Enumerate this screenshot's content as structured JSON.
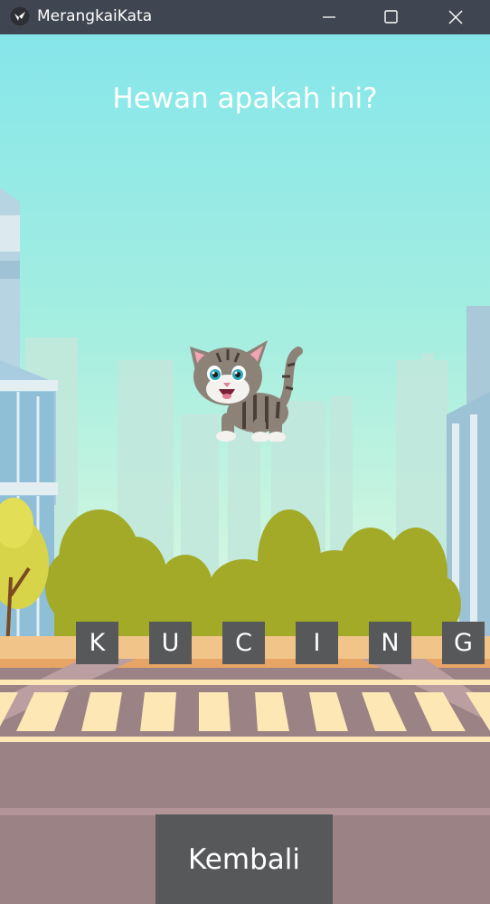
{
  "window": {
    "title": "MerangkaiKata",
    "icon": "kivy-logo-icon"
  },
  "game": {
    "question": "Hewan apakah ini?",
    "image": "cat-illustration",
    "letters": [
      "K",
      "U",
      "C",
      "I",
      "N",
      "G"
    ],
    "back_label": "Kembali"
  },
  "colors": {
    "sky_top": "#86e6ea",
    "tile_bg": "#575859",
    "titlebar_bg": "#3f4551"
  }
}
